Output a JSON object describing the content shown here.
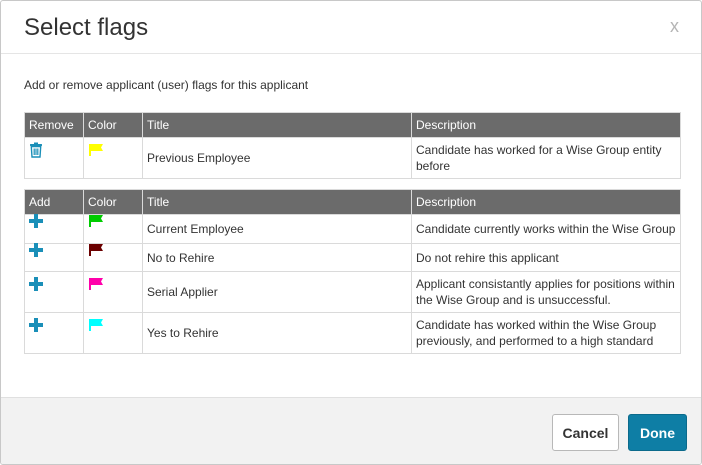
{
  "dialog": {
    "title": "Select flags",
    "close_label": "x",
    "intro": "Add or remove applicant (user) flags for this applicant"
  },
  "remove_table": {
    "headers": [
      "Remove",
      "Color",
      "Title",
      "Description"
    ],
    "rows": [
      {
        "action_icon": "trash-icon",
        "color": "#ffff00",
        "title": "Previous Employee",
        "description": "Candidate has worked for a Wise Group entity before"
      }
    ]
  },
  "add_table": {
    "headers": [
      "Add",
      "Color",
      "Title",
      "Description"
    ],
    "rows": [
      {
        "action_icon": "plus-icon",
        "color": "#00cc00",
        "title": "Current Employee",
        "description": "Candidate currently works within the Wise Group"
      },
      {
        "action_icon": "plus-icon",
        "color": "#6b0000",
        "title": "No to Rehire",
        "description": "Do not rehire this applicant"
      },
      {
        "action_icon": "plus-icon",
        "color": "#ff00aa",
        "title": "Serial Applier",
        "description": "Applicant consistantly applies for positions within the Wise Group and is unsuccessful."
      },
      {
        "action_icon": "plus-icon",
        "color": "#00ffff",
        "title": "Yes to Rehire",
        "description": "Candidate has worked within the Wise Group previously, and performed to a high standard"
      }
    ]
  },
  "footer": {
    "cancel_label": "Cancel",
    "done_label": "Done"
  },
  "colors": {
    "accent": "#0e7ea5",
    "header_bg": "#6b6b6b"
  }
}
